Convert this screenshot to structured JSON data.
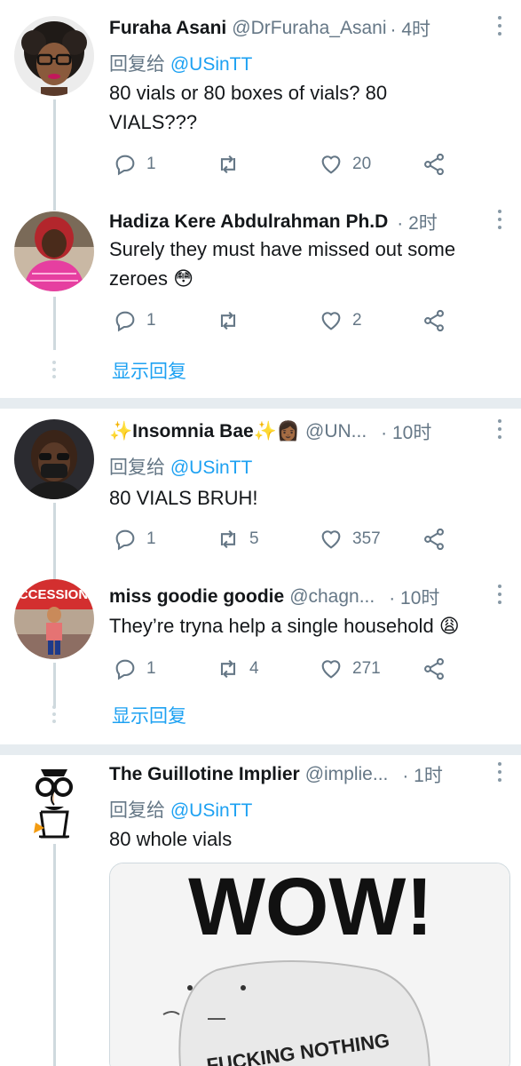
{
  "tweets": [
    {
      "name": "Furaha Asani",
      "handle": "@DrFuraha_Asani",
      "time": "· 4时",
      "reply_prefix": "回复给",
      "reply_to": "@USinTT",
      "text_lines": [
        "80 vials or 80 boxes of vials? 80",
        "VIALS???"
      ],
      "replies": "1",
      "retweets": "",
      "likes": "20"
    },
    {
      "name": "Hadiza Kere Abdulrahman Ph.D",
      "handle": "",
      "time": "· 2时",
      "text_lines": [
        "Surely they must have missed out some",
        "zeroes 😳"
      ],
      "replies": "1",
      "retweets": "",
      "likes": "2"
    },
    {
      "name_prefix": "✨",
      "name": "Insomnia Bae",
      "name_suffix": "✨👩🏾",
      "handle": "@UN...",
      "time": "· 10时",
      "reply_prefix": "回复给",
      "reply_to": "@USinTT",
      "text_lines": [
        "80 VIALS BRUH!"
      ],
      "replies": "1",
      "retweets": "5",
      "likes": "357"
    },
    {
      "name": "miss goodie goodie",
      "handle": "@chagn...",
      "time": "· 10时",
      "text_lines": [
        "They’re tryna help a single household 😩"
      ],
      "replies": "1",
      "retweets": "4",
      "likes": "271"
    },
    {
      "name": "The Guillotine Implier",
      "handle": "@implie...",
      "time": "· 1时",
      "reply_prefix": "回复给",
      "reply_to": "@USinTT",
      "text_lines": [
        "80 whole vials"
      ],
      "media_text_big": "WOW!",
      "media_text_small": "FUCKING NOTHING"
    }
  ],
  "show_replies_label": "显示回复",
  "avatar2_sign": "ACCESSION",
  "icons": {
    "reply": "reply-icon",
    "retweet": "retweet-icon",
    "like": "heart-icon",
    "share": "share-icon",
    "more": "more-vertical-icon"
  },
  "colors": {
    "accent": "#1da1f2",
    "secondary_text": "#657786",
    "separator": "#e6ecf0"
  }
}
